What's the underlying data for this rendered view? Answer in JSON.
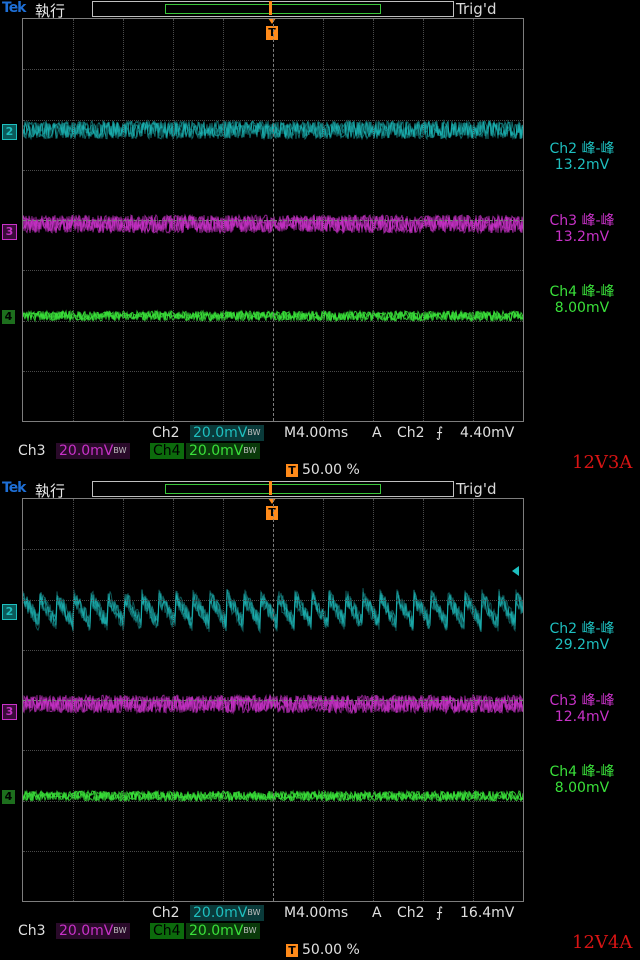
{
  "panels": [
    {
      "brand": "Tek",
      "mode": "執行",
      "trig_status": "Trig'd",
      "t_marker": "T",
      "measurements": [
        {
          "label": "Ch2 峰-峰",
          "value": "13.2mV",
          "color": "#1ebfbf"
        },
        {
          "label": "Ch3 峰-峰",
          "value": "13.2mV",
          "color": "#c832c8"
        },
        {
          "label": "Ch4 峰-峰",
          "value": "8.00mV",
          "color": "#3ae03a"
        }
      ],
      "ch_markers": [
        "2",
        "3",
        "4"
      ],
      "status": {
        "ch2_label": "Ch2",
        "ch2_scale": "20.0mV",
        "timebase": "M4.00ms",
        "trig_source_prefix": "A",
        "trig_source": "Ch2",
        "trig_level": "4.40mV",
        "ch3_label": "Ch3",
        "ch3_scale": "20.0mV",
        "ch4_label": "Ch4",
        "ch4_scale": "20.0mV",
        "trig_pos": "50.00 %",
        "bw_ch2": "BW",
        "bw_ch3": "BW",
        "bw_ch4": "BW"
      },
      "caption": "12V3A"
    },
    {
      "brand": "Tek",
      "mode": "執行",
      "trig_status": "Trig'd",
      "t_marker": "T",
      "measurements": [
        {
          "label": "Ch2 峰-峰",
          "value": "29.2mV",
          "color": "#1ebfbf"
        },
        {
          "label": "Ch3 峰-峰",
          "value": "12.4mV",
          "color": "#c832c8"
        },
        {
          "label": "Ch4 峰-峰",
          "value": "8.00mV",
          "color": "#3ae03a"
        }
      ],
      "ch_markers": [
        "2",
        "3",
        "4"
      ],
      "status": {
        "ch2_label": "Ch2",
        "ch2_scale": "20.0mV",
        "timebase": "M4.00ms",
        "trig_source_prefix": "A",
        "trig_source": "Ch2",
        "trig_level": "16.4mV",
        "ch3_label": "Ch3",
        "ch3_scale": "20.0mV",
        "ch4_label": "Ch4",
        "ch4_scale": "20.0mV",
        "trig_pos": "50.00 %",
        "bw_ch2": "BW",
        "bw_ch3": "BW",
        "bw_ch4": "BW"
      },
      "caption": "12V4A"
    }
  ],
  "colors": {
    "ch2": "#1ebfbf",
    "ch3": "#c832c8",
    "ch4": "#3ae03a",
    "trigger": "#ff8a1a",
    "caption": "#d81414"
  }
}
